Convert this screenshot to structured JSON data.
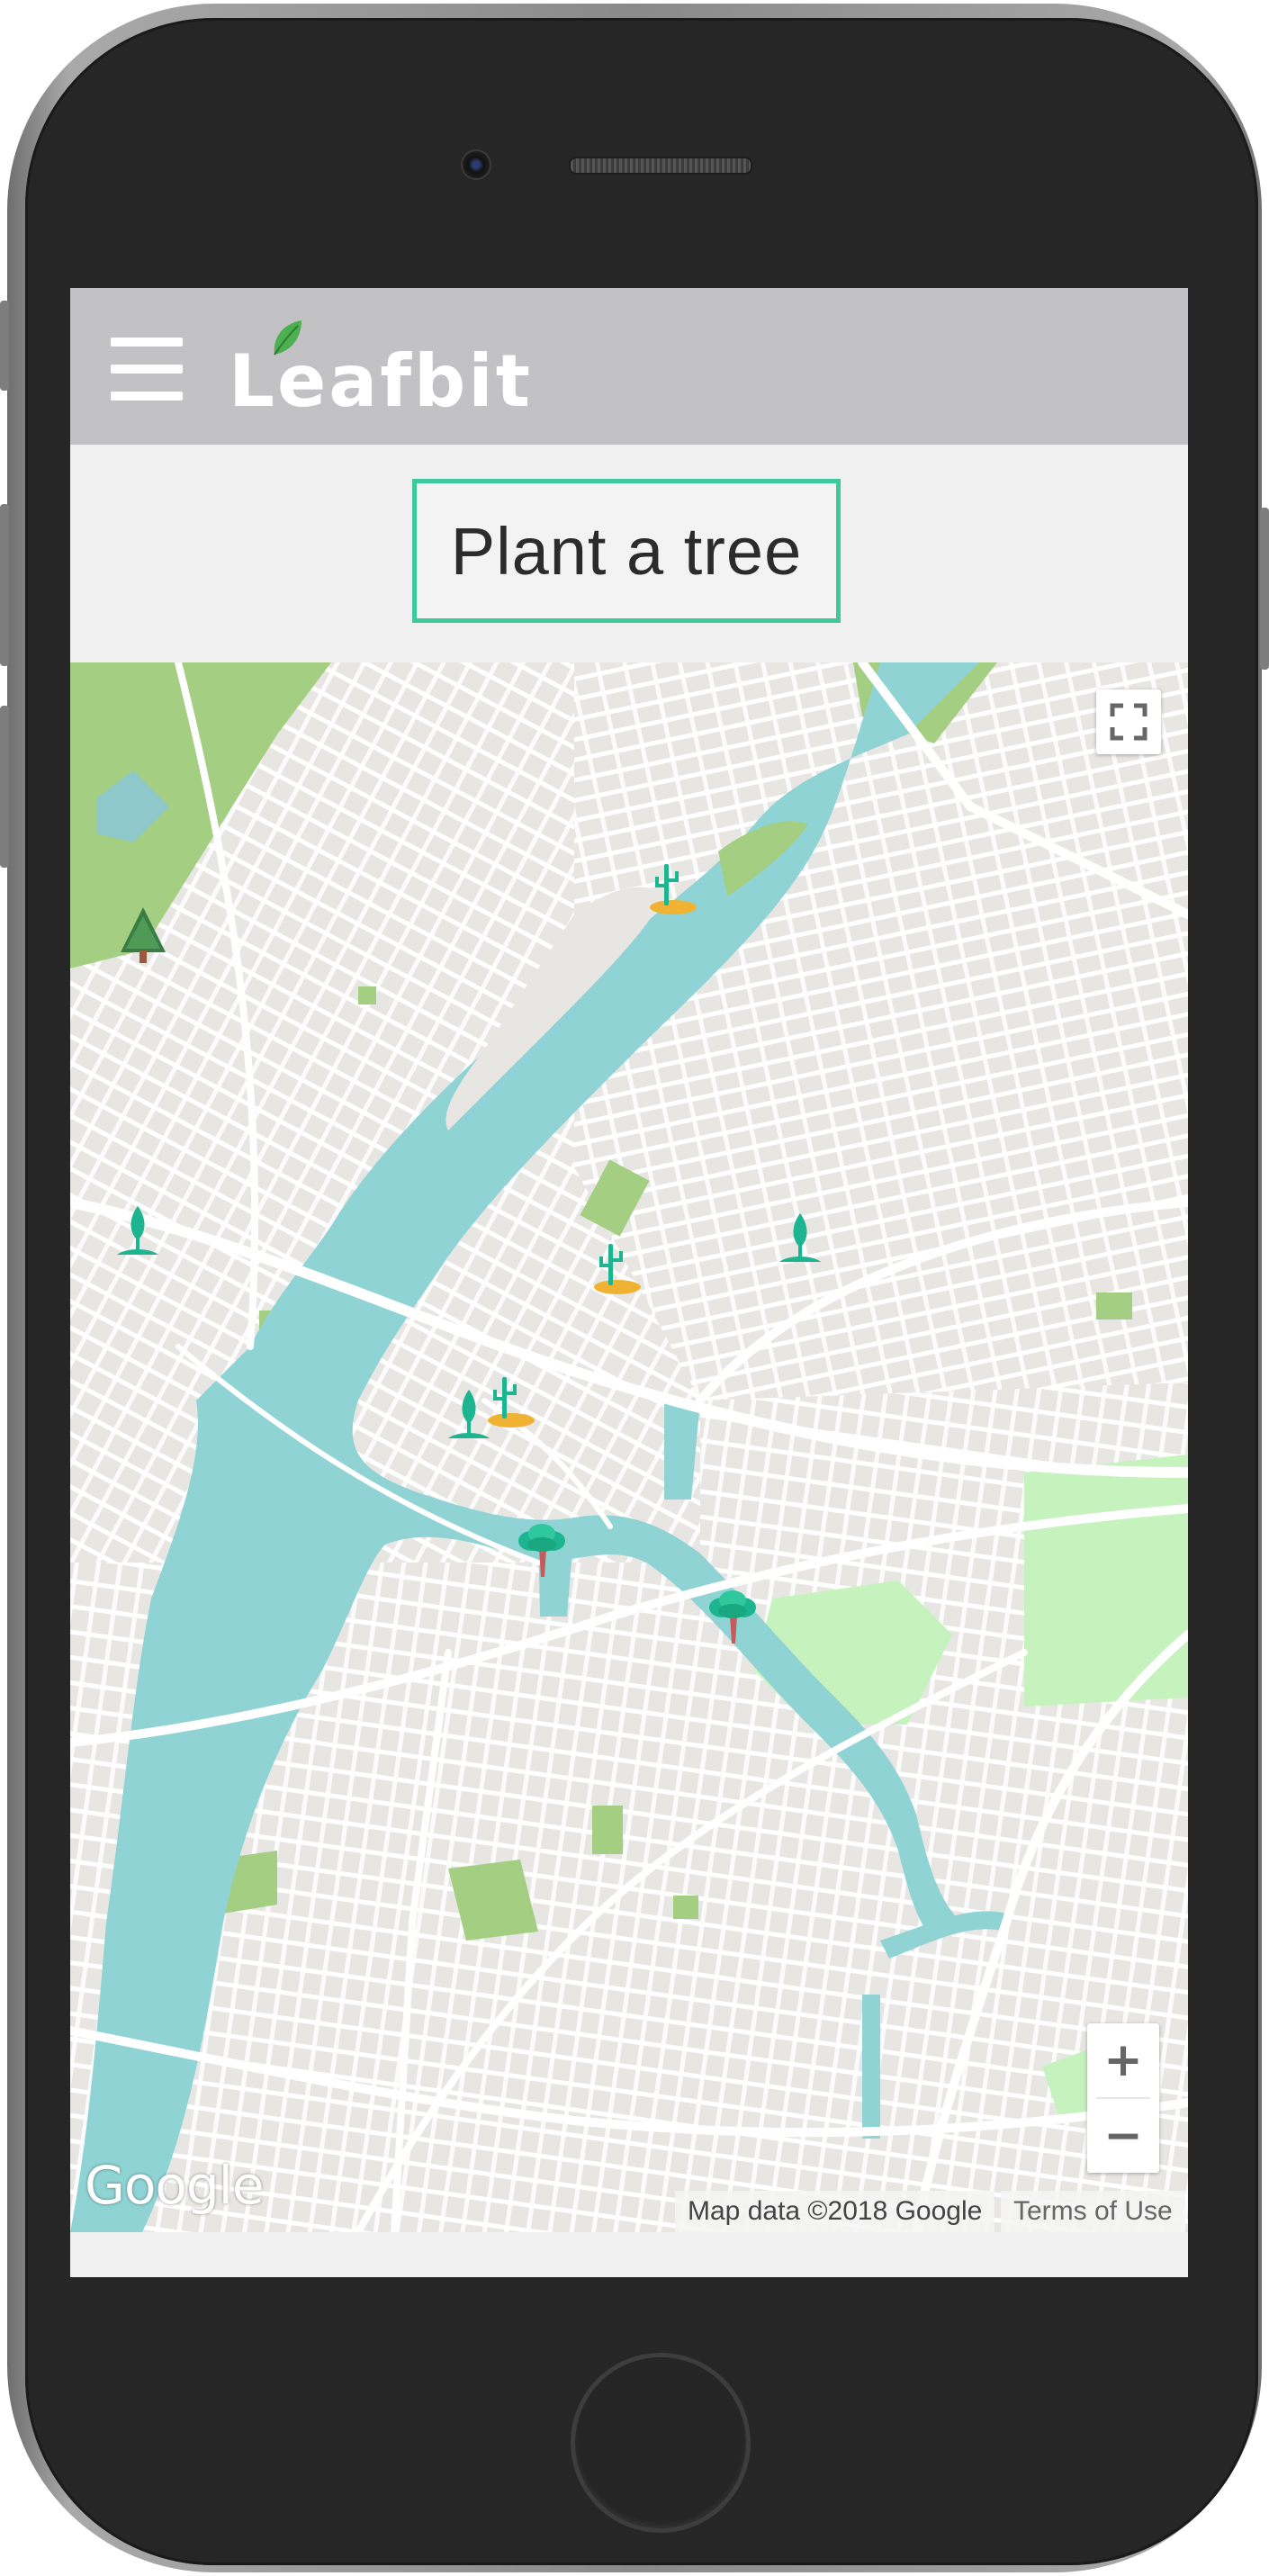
{
  "app": {
    "brand_name": "Leafbit",
    "accent_color": "#3ec99d",
    "header_color": "#c2c1c3"
  },
  "header": {
    "menu_icon": "hamburger-menu-icon",
    "logo_leaf_icon": "leaf-icon"
  },
  "actions": {
    "plant_button_label": "Plant a tree"
  },
  "map": {
    "provider_logo": "Google",
    "attribution": "Map data ©2018 Google",
    "terms_link": "Terms of Use",
    "zoom_in_label": "+",
    "zoom_out_label": "−",
    "fullscreen_icon": "fullscreen-icon",
    "markers": [
      {
        "type": "pine-tree-icon"
      },
      {
        "type": "cactus-icon"
      },
      {
        "type": "sapling-tree-icon"
      },
      {
        "type": "sapling-tree-icon"
      },
      {
        "type": "cactus-icon"
      },
      {
        "type": "sapling-tree-icon"
      },
      {
        "type": "cactus-icon"
      },
      {
        "type": "broadleaf-tree-icon"
      },
      {
        "type": "broadleaf-tree-icon"
      }
    ]
  }
}
